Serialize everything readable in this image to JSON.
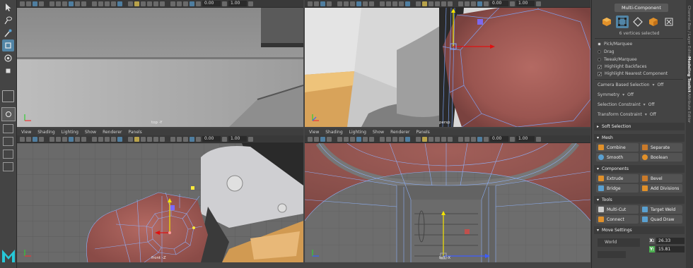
{
  "viewport_menu": [
    "View",
    "Shading",
    "Lighting",
    "Show",
    "Renderer",
    "Panels"
  ],
  "viewport_fields": {
    "value_a": "0.00",
    "value_b": "1.00"
  },
  "viewports": {
    "top_left": {
      "label": "top -Y"
    },
    "top_right": {
      "label": "persp"
    },
    "bottom_left": {
      "label": "front -Z"
    },
    "bottom_right": {
      "label": "left -X"
    }
  },
  "panel": {
    "title": "Multi-Component",
    "status": "6 vertices selected",
    "pick_modes": [
      {
        "label": "Pick/Marquee",
        "on": true
      },
      {
        "label": "Drag",
        "on": false
      },
      {
        "label": "Tweak/Marquee",
        "on": false
      }
    ],
    "checks": [
      {
        "label": "Highlight Backfaces",
        "checked": true
      },
      {
        "label": "Highlight Nearest Component",
        "checked": true
      }
    ],
    "dropdowns": [
      {
        "label": "Camera Based Selection",
        "value": "Off"
      },
      {
        "label": "Symmetry",
        "value": "Off"
      },
      {
        "label": "Selection Constraint",
        "value": "Off"
      },
      {
        "label": "Transform Constraint",
        "value": "Off"
      }
    ],
    "soft_selection": "Soft Selection",
    "mesh": {
      "title": "Mesh",
      "buttons": [
        "Combine",
        "Separate",
        "Smooth",
        "Boolean"
      ]
    },
    "components": {
      "title": "Components",
      "buttons": [
        "Extrude",
        "Bevel",
        "Bridge",
        "Add Divisions"
      ]
    },
    "tools": {
      "title": "Tools",
      "buttons": [
        "Multi-Cut",
        "Target Weld",
        "Connect",
        "Quad Draw"
      ]
    },
    "move_settings": {
      "title": "Move Settings",
      "space": "World",
      "x": "26.33",
      "y": "15.81"
    }
  },
  "side_tabs": [
    "Channel Box / Layer Editor",
    "Modeling Toolkit",
    "Attribute Editor"
  ],
  "colors": {
    "accent": "#5285a6",
    "wire": "#7fa8ff",
    "vertex": "#7b6bff",
    "manip_x": "#e01010",
    "manip_y": "#f5e600"
  }
}
